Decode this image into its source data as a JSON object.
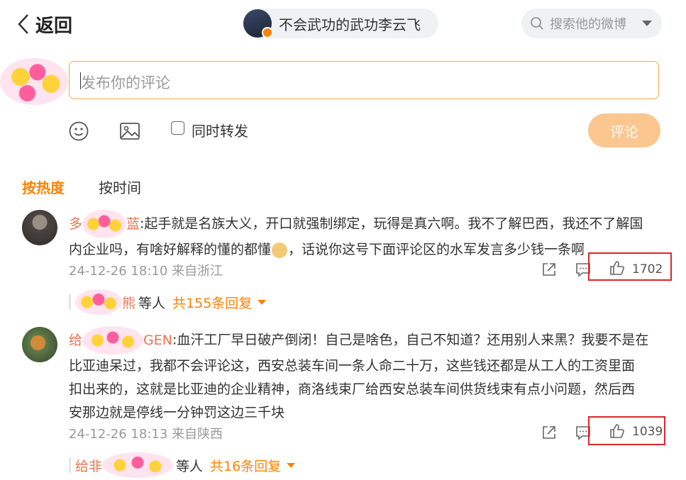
{
  "header": {
    "back_label": "返回",
    "user_name": "不会武功的武功李云飞",
    "search_placeholder": "搜索他的微博"
  },
  "composer": {
    "placeholder": "发布你的评论",
    "repost_label": "同时转发",
    "submit_label": "评论"
  },
  "sort_tabs": {
    "hot": "按热度",
    "time": "按时间"
  },
  "comments": [
    {
      "username_prefix": "多",
      "username_suffix": "蓝",
      "text_line1": ":起手就是名族大义，开口就强制绑定，玩得是真六啊。我不了解巴西，我还不了解国",
      "text_line2": "内企业吗，有啥好解释的懂的都懂",
      "text_line2b": "，话说你这号下面评论区的水军发言多少钱一条啊",
      "time": "24-12-26 18:10 来自浙江",
      "likes": "1702",
      "reply_name_suffix": "熊",
      "reply_etc": "等人",
      "reply_count": "共155条回复"
    },
    {
      "username_prefix": "给",
      "username_suffix": "GEN",
      "text_line1": ":血汗工厂早日破产倒闭！自己是啥色，自己不知道？还用别人来黑？我要不是在",
      "text_line2": "比亚迪呆过，我都不会评论这，西安总装车间一条人命二十万，这些钱还都是从工人的工资里面",
      "text_line3": "扣出来的，这就是比亚迪的企业精神，商洛线束厂给西安总装车间供货线束有点小问题，然后西",
      "text_line4": "安那边就是停线一分钟罚这边三千块",
      "time": "24-12-26 18:13 来自陕西",
      "likes": "1039",
      "reply_name_prefix": "给非",
      "reply_etc": "等人",
      "reply_count": "共16条回复"
    }
  ]
}
